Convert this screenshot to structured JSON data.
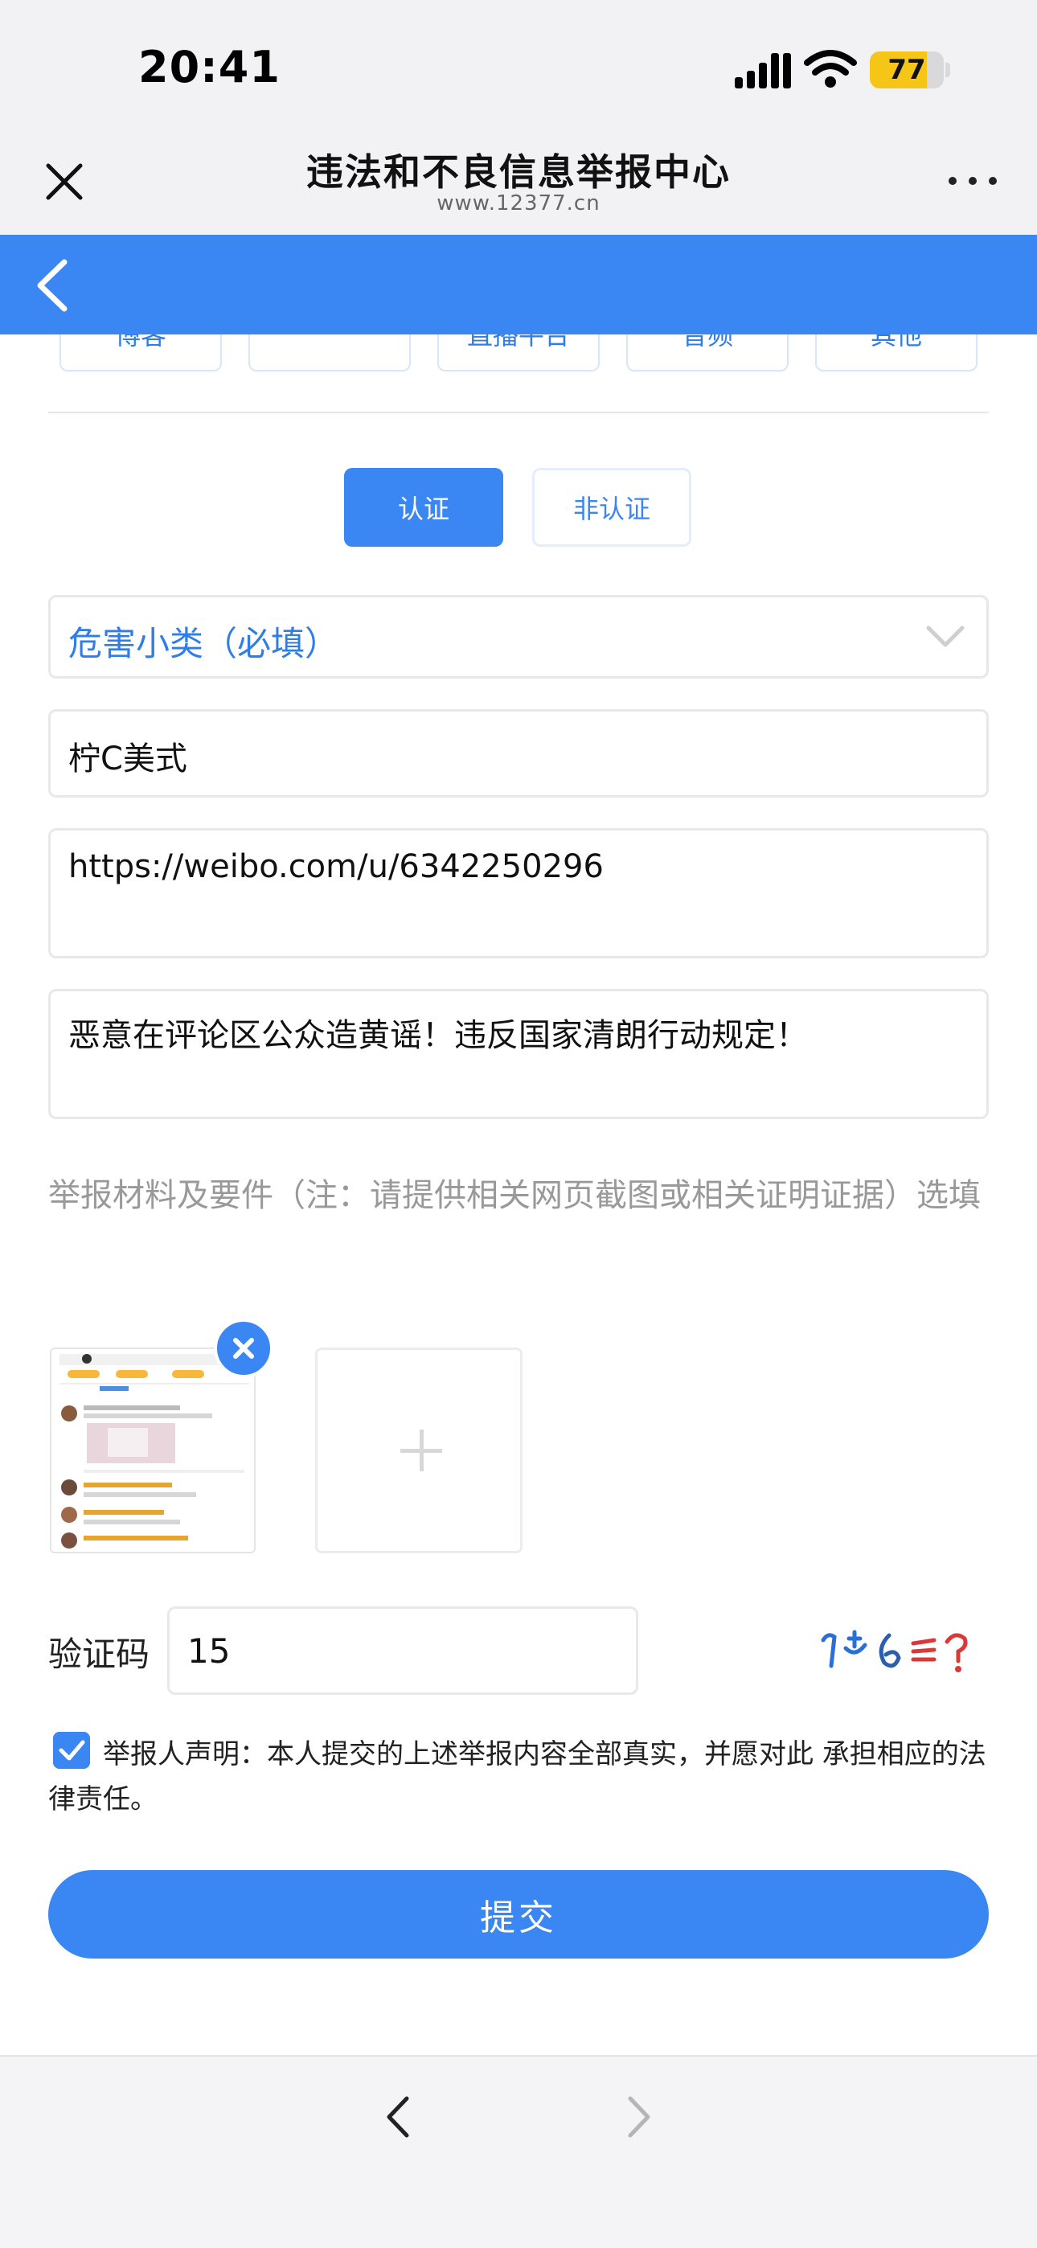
{
  "status_bar": {
    "time": "20:41",
    "battery": "77",
    "battery_level": 0.77
  },
  "browser": {
    "title": "违法和不良信息举报中心",
    "url": "www.12377.cn"
  },
  "categories": [
    {
      "label": "博客"
    },
    {
      "label": ""
    },
    {
      "label": "直播平台"
    },
    {
      "label": "音频"
    },
    {
      "label": "其他"
    }
  ],
  "auth": {
    "certified": "认证",
    "uncertified": "非认证",
    "selected": "认证"
  },
  "form": {
    "harm_subcategory_placeholder": "危害小类（必填）",
    "account_name": "柠C美式",
    "account_url": "https://weibo.com/u/6342250296",
    "description": "恶意在评论区公众造黄谣！违反国家清朗行动规定！",
    "materials_note": "举报材料及要件（注：请提供相关网页截图或相关证明证据）选填",
    "captcha_label": "验证码",
    "captcha_value": "15",
    "declaration": "举报人声明：本人提交的上述举报内容全部真实，并愿对此 承担相应的法律责任。",
    "submit_label": "提交"
  },
  "colors": {
    "accent": "#3a86f2",
    "placeholder": "#999999"
  },
  "icons": {
    "close": "close-icon",
    "more": "more-icon",
    "back": "back-icon",
    "chevron": "chevron-down-icon",
    "remove": "remove-icon",
    "add": "add-icon"
  }
}
